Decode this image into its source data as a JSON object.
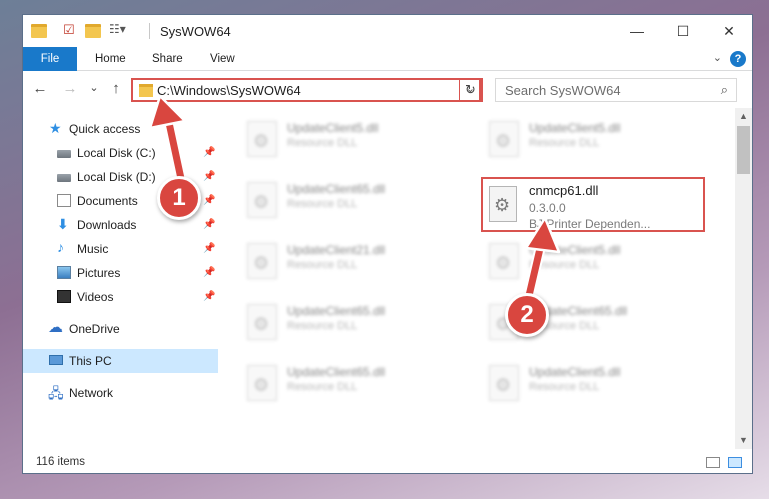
{
  "window": {
    "title": "SysWOW64",
    "controls": {
      "minimize": "—",
      "maximize": "☐",
      "close": "✕"
    }
  },
  "ribbon": {
    "tabs": [
      "File",
      "Home",
      "Share",
      "View"
    ],
    "help": "?"
  },
  "nav": {
    "back": "←",
    "forward": "→",
    "recent": "⌄",
    "up": "↑",
    "address": "C:\\Windows\\SysWOW64",
    "refresh": "↻",
    "search_placeholder": "Search SysWOW64"
  },
  "sidebar": {
    "items": [
      {
        "label": "Quick access",
        "icon": "star-icon",
        "pinned": false
      },
      {
        "label": "Local Disk (C:)",
        "icon": "disk-icon",
        "pinned": true
      },
      {
        "label": "Local Disk (D:)",
        "icon": "disk-icon",
        "pinned": true
      },
      {
        "label": "Documents",
        "icon": "documents-icon",
        "pinned": true
      },
      {
        "label": "Downloads",
        "icon": "download-icon",
        "pinned": true
      },
      {
        "label": "Music",
        "icon": "music-icon",
        "pinned": true
      },
      {
        "label": "Pictures",
        "icon": "pictures-icon",
        "pinned": true
      },
      {
        "label": "Videos",
        "icon": "videos-icon",
        "pinned": true
      },
      {
        "label": "OneDrive",
        "icon": "cloud-icon",
        "pinned": false
      },
      {
        "label": "This PC",
        "icon": "pc-icon",
        "pinned": false,
        "selected": true
      },
      {
        "label": "Network",
        "icon": "network-icon",
        "pinned": false
      }
    ]
  },
  "files": [
    {
      "name": "UpdateClient5.dll",
      "type": "Resource DLL"
    },
    {
      "name": "UpdateClient5.dll",
      "type": "Resource DLL"
    },
    {
      "name": "UpdateClient65.dll",
      "type": "Resource DLL"
    },
    {
      "name": "UpdateClient21.dll",
      "type": "Resource DLL"
    },
    {
      "name": "UpdateClient5.dll",
      "type": "Resource DLL"
    },
    {
      "name": "UpdateClient65.dll",
      "type": "Resource DLL"
    },
    {
      "name": "UpdateClient65.dll",
      "type": "Resource DLL"
    },
    {
      "name": "UpdateClient65.dll",
      "type": "Resource DLL"
    },
    {
      "name": "UpdateClient5.dll",
      "type": "Resource DLL"
    }
  ],
  "highlighted_file": {
    "name": "cnmcp61.dll",
    "version": "0.3.0.0",
    "description": "BJ Printer Dependen..."
  },
  "status": {
    "item_count": "116 items"
  },
  "annotations": {
    "step1": "1",
    "step2": "2",
    "color": "#d9463f"
  }
}
